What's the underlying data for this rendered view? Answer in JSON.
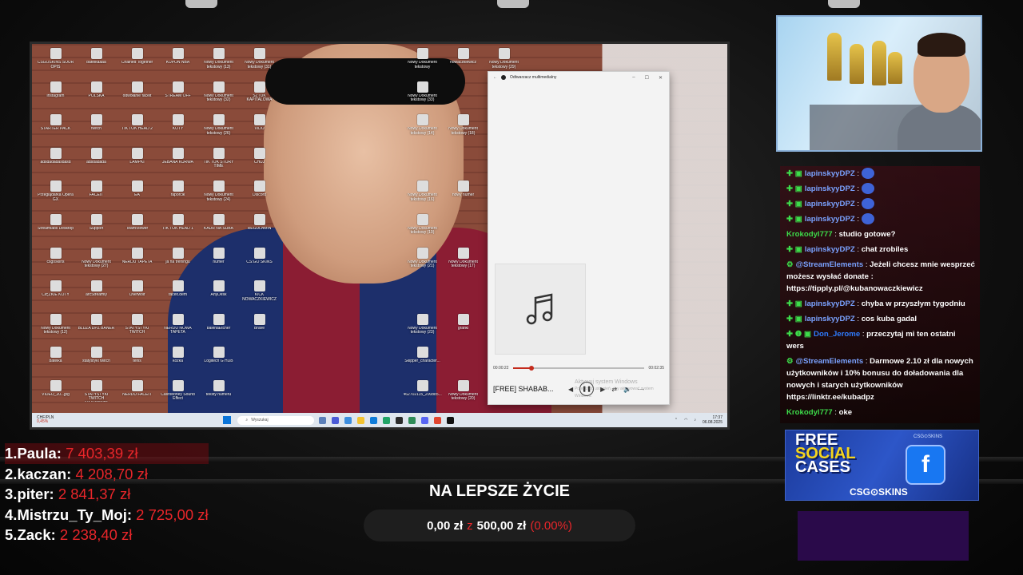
{
  "desktop": {
    "icons": [
      "CSGOSKINS SOUR OPIS",
      "batelkaaaa",
      "Chained Together",
      "KUPON NBA",
      "Nowy Dokument tekstowy (13)",
      "Nowy Dokument tekstowy (31)",
      "",
      "",
      "",
      "Nowy Dokument tekstowy",
      "nowaczkiewicz",
      "Nowy Dokument tekstowy (29)",
      "instagram",
      "POLSKA",
      "odwołanie faceit",
      "STREAM OFF",
      "Nowy Dokument tekstowy (32)",
      "SZTUK KAPITALOWA",
      "",
      "",
      "",
      "Nowy Dokument tekstowy (33)",
      "",
      "",
      "STARTER PACK",
      "twitch",
      "TIK TOK HEAD 2",
      "KOTY",
      "Nowy Dokument tekstowy (26)",
      "VIDO",
      "",
      "",
      "",
      "Nowy Dokument tekstowy (14)",
      "Nowy Dokument tekstowy (18)",
      "",
      "adsdadadasdasd",
      "adsdadada",
      "LAMPKI",
      "JEBANA KURWA",
      "TIK TOK STORY TIME",
      "CHUJ",
      "",
      "",
      "",
      "",
      "",
      "",
      "Przeglądarka Opera GX",
      "FACEIT",
      "EA",
      "raporcik",
      "Nowy Dokument tekstowy (24)",
      "Discord",
      "",
      "",
      "",
      "Nowy Dokument tekstowy (16)",
      "nowy numer",
      "",
      "Streamlabs Desktop",
      "Support",
      "TeamViewer",
      "TIK TOK HEAD 1",
      "KADR NA SUBA",
      "REGULAMIN",
      "",
      "",
      "",
      "Nowy Dokument tekstowy (19)",
      "",
      "",
      "csgoskins",
      "Nowy Dokument tekstowy (27)",
      "NERDU TAPETA",
      "ja na treningu",
      "numer",
      "CS:GO SKINS",
      "",
      "",
      "",
      "Nowy Dokument tekstowy (21)",
      "Nowy Dokument tekstowy (17)",
      "",
      "CIĘŻKIE KOTY",
      "arcStreamly",
      "Overwolf",
      "faceit.dem",
      "AnyDesk",
      "KICK NOWACZKIEWICZ",
      "",
      "",
      "",
      "",
      "",
      "",
      "Nowy Dokument tekstowy (12)",
      "BLUZA DPZ BANER",
      "STATYSTYKI TWITCH",
      "NERDU NOWA TAPETA",
      "balenaEtcher",
      "Brave",
      "",
      "",
      "",
      "Nowy Dokument tekstowy (23)",
      "grafiki",
      "",
      "batelka",
      "statystyki twitch",
      "tenis",
      "kozka",
      "Logitech G HUB",
      "",
      "",
      "",
      "",
      "Skipper_character...",
      "",
      "",
      "VIDEO_20...jpg",
      "STATYSTYKI TWITCH NAJLEPSZE",
      "NERDU FACEIT",
      "CashMoney Sound Effect",
      "teksty numeru",
      "",
      "",
      "",
      "",
      "462702115_200885...",
      "Nowy Dokument tekstowy (20)",
      ""
    ],
    "taskbar": {
      "weather_line1": "CHF/PLN",
      "weather_line2": "0,45%",
      "search_placeholder": "Wyszukaj",
      "time": "17:37",
      "date": "06.08.2025"
    }
  },
  "player": {
    "title": "Odtwarzacz multimedialny",
    "song": "[FREE] SHABAB...",
    "elapsed": "00:00:22",
    "duration": "00:02:35",
    "progress": 0.14,
    "watermark_line1": "Aktywuj system Windows",
    "watermark_line2": "Przejdź do ustawień, aby aktywować system Windows."
  },
  "chat": {
    "messages": [
      {
        "user": "lapinskyyDPZ",
        "color": "#7aa2ff",
        "badge": "✚ ▣",
        "text": "",
        "emote": true
      },
      {
        "user": "lapinskyyDPZ",
        "color": "#7aa2ff",
        "badge": "✚ ▣",
        "text": "",
        "emote": true
      },
      {
        "user": "lapinskyyDPZ",
        "color": "#7aa2ff",
        "badge": "✚ ▣",
        "text": "",
        "emote": true
      },
      {
        "user": "lapinskyyDPZ",
        "color": "#7aa2ff",
        "badge": "✚ ▣",
        "text": "",
        "emote": true
      },
      {
        "user": "Krokodyl777",
        "color": "#3ddc4a",
        "badge": "",
        "text": "studio gotowe?",
        "emote": false
      },
      {
        "user": "lapinskyyDPZ",
        "color": "#7aa2ff",
        "badge": "✚ ▣",
        "text": "chat zrobiles",
        "emote": false
      },
      {
        "user": "@StreamElements",
        "color": "#7aa2ff",
        "badge": "⚙",
        "text": "Jeżeli chcesz mnie wesprzeć możesz wysłać donate : https://tipply.pl/@kubanowaczkiewicz",
        "emote": false
      },
      {
        "user": "lapinskyyDPZ",
        "color": "#7aa2ff",
        "badge": "✚ ▣",
        "text": "chyba w przyszłym tygodniu",
        "emote": false
      },
      {
        "user": "lapinskyyDPZ",
        "color": "#7aa2ff",
        "badge": "✚ ▣",
        "text": "cos kuba gadal",
        "emote": false
      },
      {
        "user": "Don_Jerome",
        "color": "#2f7cff",
        "badge": "✚ ❶ ▣",
        "text": "przeczytaj mi ten ostatni wers",
        "emote": false
      },
      {
        "user": "@StreamElements",
        "color": "#7aa2ff",
        "badge": "⚙",
        "text": "Darmowe 2.10 zł dla nowych użytkowników i 10% bonusu do doładowania dla nowych i starych użytkowników https://linktr.ee/kubadpz",
        "emote": false
      },
      {
        "user": "Krokodyl777",
        "color": "#3ddc4a",
        "badge": "",
        "text": "oke",
        "emote": false
      }
    ]
  },
  "promo": {
    "line1": "FREE",
    "line2": "SOCIAL",
    "line3": "CASES",
    "brand": "CSG⊙SKINS",
    "tag": "CSG⊙SKINS",
    "fb": "f"
  },
  "leaderboard": [
    {
      "rank": "1.",
      "name": "Paula:",
      "amount": "7 403,39 zł"
    },
    {
      "rank": "2.",
      "name": "kaczan:",
      "amount": "4 208,70 zł"
    },
    {
      "rank": "3.",
      "name": "piter:",
      "amount": "2 841,37 zł"
    },
    {
      "rank": "4.",
      "name": "Mistrzu_Ty_Moj:",
      "amount": "2 725,00 zł"
    },
    {
      "rank": "5.",
      "name": "Zack:",
      "amount": "2 238,40 zł"
    }
  ],
  "goal": {
    "title": "NA LEPSZE ŻYCIE",
    "current": "0,00 zł",
    "separator": "z",
    "target": "500,00 zł",
    "percent": "(0.00%)"
  }
}
